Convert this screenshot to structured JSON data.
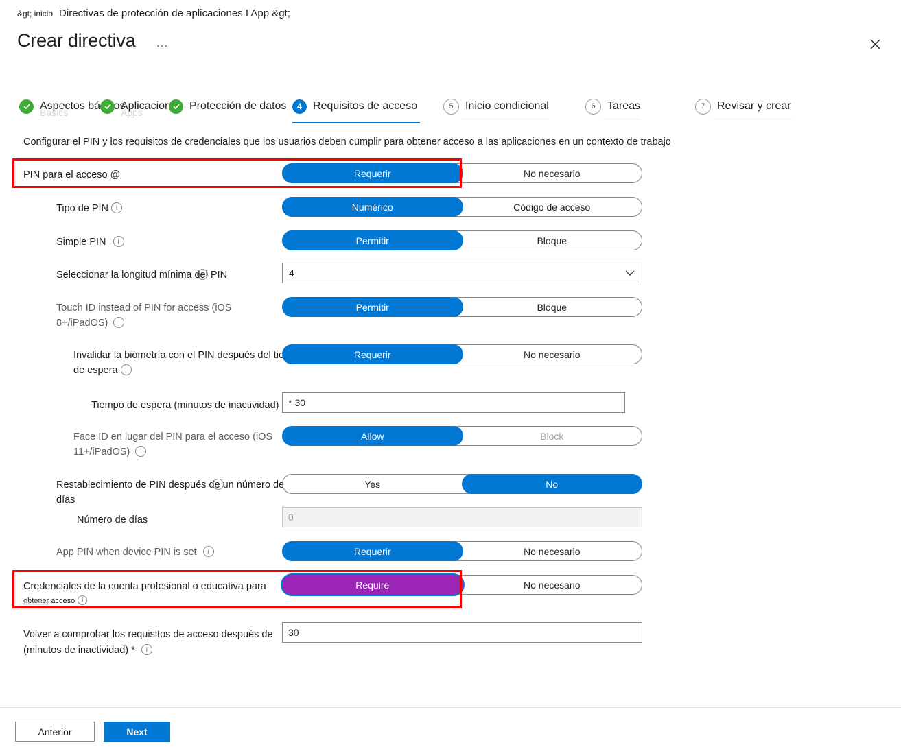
{
  "header": {
    "breadcrumb_small": "&gt; inicio",
    "breadcrumb_main": "Directivas de protección de aplicaciones I App &gt;",
    "title": "Crear directiva",
    "ellipsis": "...",
    "close_icon": "close-icon"
  },
  "wizard": {
    "steps": [
      {
        "num": "1",
        "label": "Aspectos básicos",
        "state": "done",
        "ghost": "Basics"
      },
      {
        "num": "2",
        "label": "Aplicaciones",
        "state": "done",
        "ghost": "Apps"
      },
      {
        "num": "3",
        "label": "Protección de datos",
        "state": "done",
        "ghost": ""
      },
      {
        "num": "4",
        "label": "Requisitos de acceso",
        "state": "current",
        "ghost": ""
      },
      {
        "num": "5",
        "label": "Inicio condicional",
        "state": "pending",
        "ghost": ""
      },
      {
        "num": "6",
        "label": "Tareas",
        "state": "pending",
        "ghost": ""
      },
      {
        "num": "7",
        "label": "Revisar y crear",
        "state": "pending",
        "ghost": ""
      }
    ]
  },
  "description": "Configurar el PIN y los requisitos de credenciales que los usuarios deben cumplir para obtener acceso a las aplicaciones en un contexto de trabajo",
  "form": {
    "pin_for_access": {
      "label": "PIN para el acceso @",
      "options": [
        "Requerir",
        "No necesario"
      ],
      "selected": "Requerir"
    },
    "pin_type": {
      "label": "Tipo de PIN",
      "options": [
        "Numérico",
        "Código de acceso"
      ],
      "selected": "Numérico"
    },
    "simple_pin": {
      "label": "Simple PIN",
      "options": [
        "Permitir",
        "Bloque"
      ],
      "selected": "Permitir"
    },
    "min_pin_length": {
      "label": "Seleccionar la longitud mínima del PIN",
      "value": "4",
      "chevron": "chevron-down-icon"
    },
    "touch_id": {
      "label": "Touch ID instead of PIN for access (iOS 8+/iPadOS)",
      "options": [
        "Permitir",
        "Bloque"
      ],
      "selected": "Permitir"
    },
    "override_biometrics": {
      "label": "Invalidar la biometría con el PIN después del tiempo de espera",
      "options": [
        "Requerir",
        "No necesario"
      ],
      "selected": "Requerir"
    },
    "timeout": {
      "label": "Tiempo de espera (minutos de inactividad)",
      "required_mark": "*",
      "value": "30"
    },
    "face_id": {
      "label": "Face ID en lugar del PIN para el acceso (iOS 11+/iPadOS)",
      "options": [
        "Allow",
        "Block"
      ],
      "selected": "Allow"
    },
    "pin_reset": {
      "label": "Restablecimiento de PIN después de un número de días",
      "options": [
        "Yes",
        "No"
      ],
      "selected": "No"
    },
    "number_of_days": {
      "label": "Número de días",
      "value": "0",
      "disabled": true
    },
    "app_pin_device_pin": {
      "label": "App PIN when device PIN is set",
      "options": [
        "Requerir",
        "No necesario"
      ],
      "selected": "Requerir"
    },
    "work_credentials": {
      "label_line1": "Credenciales de la cuenta profesional o educativa para",
      "label_line2": "obtener acceso",
      "ghost_line2": "access",
      "options": [
        "Require",
        "No necesario"
      ],
      "selected": "Require",
      "selected_color": "#9b26b6"
    },
    "recheck_access": {
      "label_line1": "Volver a comprobar los requisitos de acceso después de",
      "label_line2": "(minutos de inactividad) *",
      "value": "30"
    }
  },
  "annotations": {
    "highlight_color": "#ff0000",
    "boxes": [
      "pin-for-access-row",
      "work-credentials-row"
    ]
  },
  "footer": {
    "previous_label": "Anterior",
    "next_label": "Next"
  }
}
